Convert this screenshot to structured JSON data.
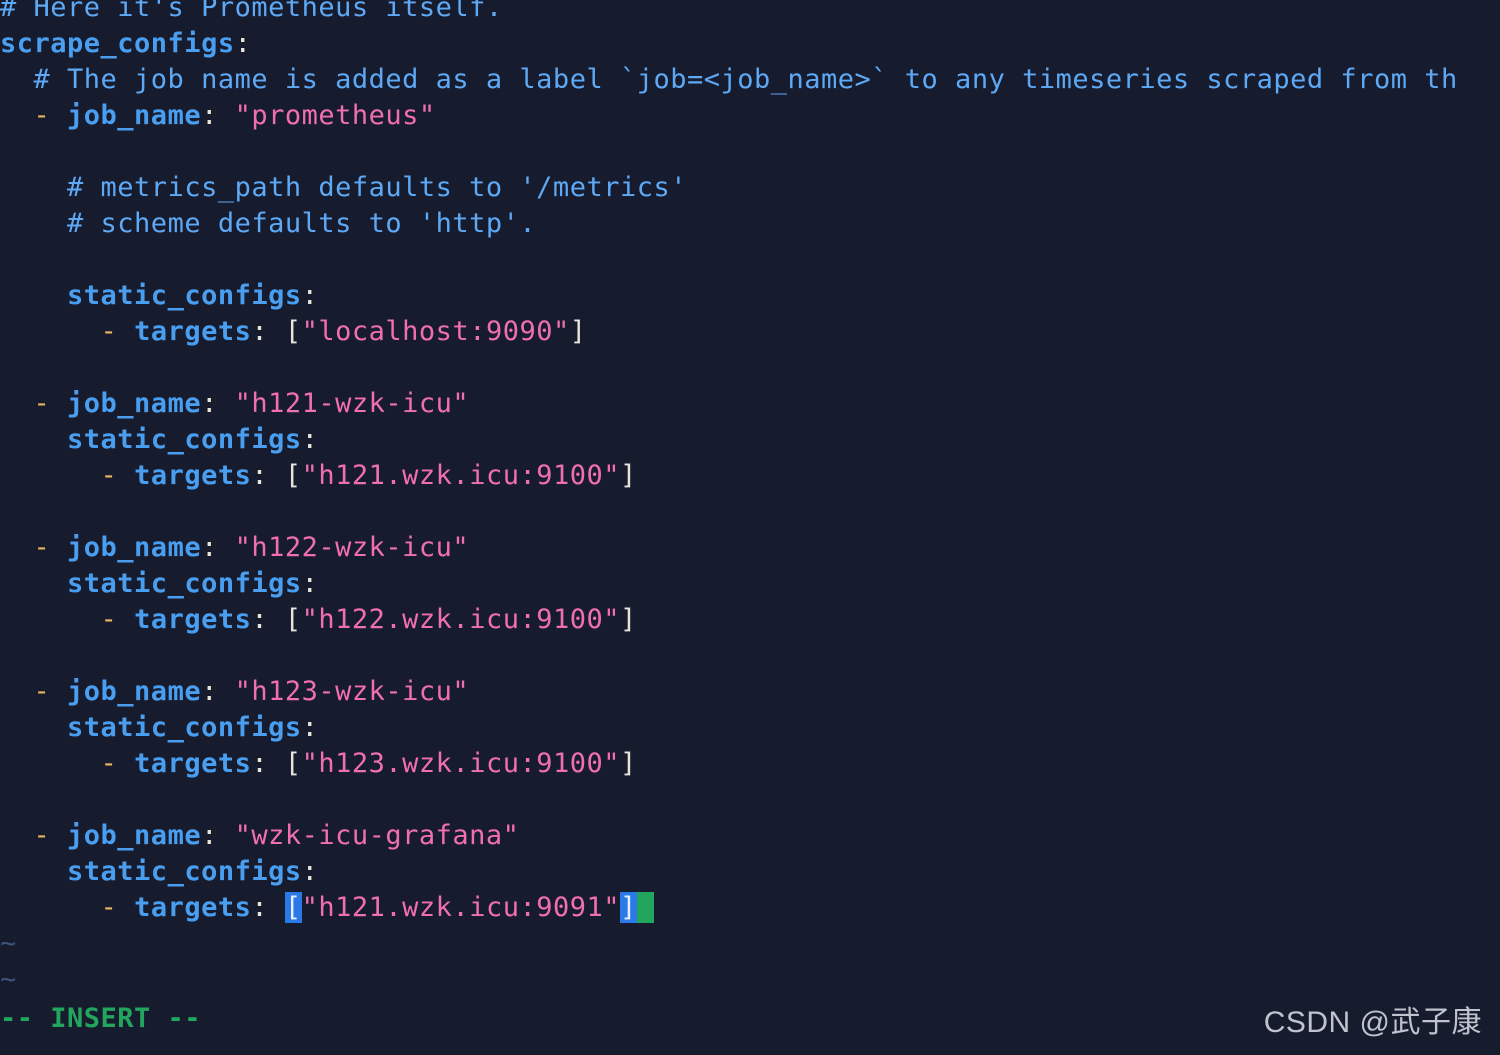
{
  "editor": {
    "app": "vim",
    "mode_label": "-- INSERT --",
    "filler_char": "~",
    "colors": {
      "background": "#161b2e",
      "comment": "#5ea9f5",
      "key": "#4a9ef0",
      "string": "#f06fae",
      "punctuation": "#e8e4dc",
      "list_dash": "#e8b464",
      "bracket_match_bg": "#2979e8",
      "cursor_bg": "#22a55c",
      "status_text": "#22a55c",
      "tilde": "#3b5377",
      "watermark": "#cdd2dc"
    }
  },
  "code": {
    "lines": [
      {
        "id": "line-comment-here",
        "indent": "",
        "tokens": [
          {
            "type": "cmt",
            "text": "# Here it's Prometheus itself."
          }
        ]
      },
      {
        "id": "line-scrape-configs",
        "indent": "",
        "tokens": [
          {
            "type": "key",
            "text": "scrape_configs"
          },
          {
            "type": "punc",
            "text": ":"
          }
        ]
      },
      {
        "id": "line-comment-jobname",
        "indent": "  ",
        "tokens": [
          {
            "type": "cmt",
            "text": "# The job name is added as a label `job=<job_name>` to any timeseries scraped from th"
          }
        ]
      },
      {
        "id": "line-job-prometheus",
        "indent": "  ",
        "tokens": [
          {
            "type": "dash",
            "text": "- "
          },
          {
            "type": "key",
            "text": "job_name"
          },
          {
            "type": "punc",
            "text": ": "
          },
          {
            "type": "str",
            "text": "\"prometheus\""
          }
        ]
      },
      {
        "id": "line-blank-1",
        "indent": "",
        "tokens": []
      },
      {
        "id": "line-comment-metricspath",
        "indent": "    ",
        "tokens": [
          {
            "type": "cmt",
            "text": "# metrics_path defaults to '/metrics'"
          }
        ]
      },
      {
        "id": "line-comment-scheme",
        "indent": "    ",
        "tokens": [
          {
            "type": "cmt",
            "text": "# scheme defaults to 'http'."
          }
        ]
      },
      {
        "id": "line-blank-2",
        "indent": "",
        "tokens": []
      },
      {
        "id": "line-static-configs-1",
        "indent": "    ",
        "tokens": [
          {
            "type": "key",
            "text": "static_configs"
          },
          {
            "type": "punc",
            "text": ":"
          }
        ]
      },
      {
        "id": "line-targets-localhost",
        "indent": "      ",
        "tokens": [
          {
            "type": "dash",
            "text": "- "
          },
          {
            "type": "key",
            "text": "targets"
          },
          {
            "type": "punc",
            "text": ": "
          },
          {
            "type": "brkt",
            "text": "["
          },
          {
            "type": "str",
            "text": "\"localhost:9090\""
          },
          {
            "type": "brkt",
            "text": "]"
          }
        ]
      },
      {
        "id": "line-blank-3",
        "indent": "",
        "tokens": []
      },
      {
        "id": "line-job-h121",
        "indent": "  ",
        "tokens": [
          {
            "type": "dash",
            "text": "- "
          },
          {
            "type": "key",
            "text": "job_name"
          },
          {
            "type": "punc",
            "text": ": "
          },
          {
            "type": "str",
            "text": "\"h121-wzk-icu\""
          }
        ]
      },
      {
        "id": "line-static-configs-2",
        "indent": "    ",
        "tokens": [
          {
            "type": "key",
            "text": "static_configs"
          },
          {
            "type": "punc",
            "text": ":"
          }
        ]
      },
      {
        "id": "line-targets-h121",
        "indent": "      ",
        "tokens": [
          {
            "type": "dash",
            "text": "- "
          },
          {
            "type": "key",
            "text": "targets"
          },
          {
            "type": "punc",
            "text": ": "
          },
          {
            "type": "brkt",
            "text": "["
          },
          {
            "type": "str",
            "text": "\"h121.wzk.icu:9100\""
          },
          {
            "type": "brkt",
            "text": "]"
          }
        ]
      },
      {
        "id": "line-blank-4",
        "indent": "",
        "tokens": []
      },
      {
        "id": "line-job-h122",
        "indent": "  ",
        "tokens": [
          {
            "type": "dash",
            "text": "- "
          },
          {
            "type": "key",
            "text": "job_name"
          },
          {
            "type": "punc",
            "text": ": "
          },
          {
            "type": "str",
            "text": "\"h122-wzk-icu\""
          }
        ]
      },
      {
        "id": "line-static-configs-3",
        "indent": "    ",
        "tokens": [
          {
            "type": "key",
            "text": "static_configs"
          },
          {
            "type": "punc",
            "text": ":"
          }
        ]
      },
      {
        "id": "line-targets-h122",
        "indent": "      ",
        "tokens": [
          {
            "type": "dash",
            "text": "- "
          },
          {
            "type": "key",
            "text": "targets"
          },
          {
            "type": "punc",
            "text": ": "
          },
          {
            "type": "brkt",
            "text": "["
          },
          {
            "type": "str",
            "text": "\"h122.wzk.icu:9100\""
          },
          {
            "type": "brkt",
            "text": "]"
          }
        ]
      },
      {
        "id": "line-blank-5",
        "indent": "",
        "tokens": []
      },
      {
        "id": "line-job-h123",
        "indent": "  ",
        "tokens": [
          {
            "type": "dash",
            "text": "- "
          },
          {
            "type": "key",
            "text": "job_name"
          },
          {
            "type": "punc",
            "text": ": "
          },
          {
            "type": "str",
            "text": "\"h123-wzk-icu\""
          }
        ]
      },
      {
        "id": "line-static-configs-4",
        "indent": "    ",
        "tokens": [
          {
            "type": "key",
            "text": "static_configs"
          },
          {
            "type": "punc",
            "text": ":"
          }
        ]
      },
      {
        "id": "line-targets-h123",
        "indent": "      ",
        "tokens": [
          {
            "type": "dash",
            "text": "- "
          },
          {
            "type": "key",
            "text": "targets"
          },
          {
            "type": "punc",
            "text": ": "
          },
          {
            "type": "brkt",
            "text": "["
          },
          {
            "type": "str",
            "text": "\"h123.wzk.icu:9100\""
          },
          {
            "type": "brkt",
            "text": "]"
          }
        ]
      },
      {
        "id": "line-blank-6",
        "indent": "",
        "tokens": []
      },
      {
        "id": "line-job-grafana",
        "indent": "  ",
        "tokens": [
          {
            "type": "dash",
            "text": "- "
          },
          {
            "type": "key",
            "text": "job_name"
          },
          {
            "type": "punc",
            "text": ": "
          },
          {
            "type": "str",
            "text": "\"wzk-icu-grafana\""
          }
        ]
      },
      {
        "id": "line-static-configs-5",
        "indent": "    ",
        "tokens": [
          {
            "type": "key",
            "text": "static_configs"
          },
          {
            "type": "punc",
            "text": ":"
          }
        ]
      },
      {
        "id": "line-targets-grafana",
        "indent": "      ",
        "tokens": [
          {
            "type": "dash",
            "text": "- "
          },
          {
            "type": "key",
            "text": "targets"
          },
          {
            "type": "punc",
            "text": ": "
          },
          {
            "type": "brkt-hl",
            "text": "["
          },
          {
            "type": "str",
            "text": "\"h121.wzk.icu:9091\""
          },
          {
            "type": "brkt-hl",
            "text": "]"
          },
          {
            "type": "cursor",
            "text": " "
          }
        ]
      },
      {
        "id": "line-tilde-1",
        "indent": "",
        "tokens": [
          {
            "type": "tilde",
            "text": "~"
          }
        ]
      },
      {
        "id": "line-tilde-2",
        "indent": "",
        "tokens": [
          {
            "type": "tilde",
            "text": "~"
          }
        ]
      }
    ]
  },
  "watermark": {
    "text": "CSDN @武子康"
  }
}
